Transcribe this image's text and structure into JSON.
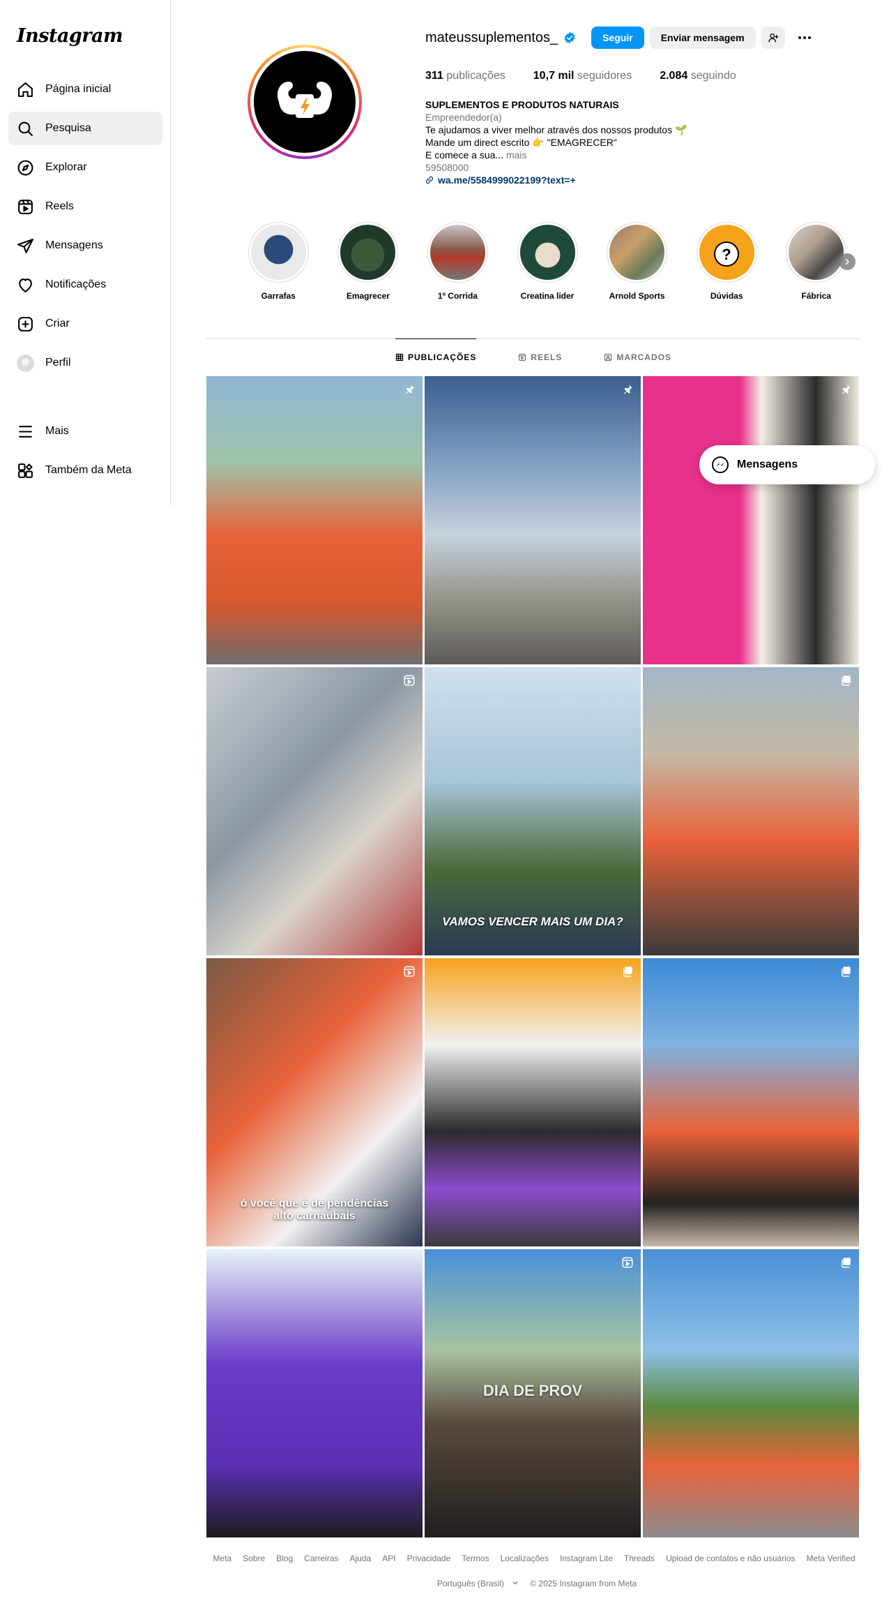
{
  "app": {
    "logo": "Instagram"
  },
  "nav": {
    "items": [
      {
        "label": "Página inicial",
        "icon": "home-icon"
      },
      {
        "label": "Pesquisa",
        "icon": "search-icon"
      },
      {
        "label": "Explorar",
        "icon": "explore-icon"
      },
      {
        "label": "Reels",
        "icon": "reels-icon"
      },
      {
        "label": "Mensagens",
        "icon": "messages-icon"
      },
      {
        "label": "Notificações",
        "icon": "heart-icon"
      },
      {
        "label": "Criar",
        "icon": "create-icon"
      },
      {
        "label": "Perfil",
        "icon": "avatar"
      }
    ],
    "bottom": [
      {
        "label": "Mais",
        "icon": "menu-icon"
      },
      {
        "label": "Também da Meta",
        "icon": "meta-apps-icon"
      }
    ],
    "active": "Pesquisa"
  },
  "profile": {
    "username": "mateussuplementos_",
    "verified": true,
    "follow_label": "Seguir",
    "message_label": "Enviar mensagem",
    "stats": {
      "posts_value": "311",
      "posts_label": "publicações",
      "followers_value": "10,7 mil",
      "followers_label": "seguidores",
      "following_value": "2.084",
      "following_label": "seguindo"
    },
    "bio": {
      "name": "SUPLEMENTOS E PRODUTOS NATURAIS",
      "category": "Empreendedor(a)",
      "line1": "Te ajudamos a viver melhor através dos nossos produtos 🌱",
      "line2": "Mande um direct escrito 👉 \"EMAGRECER\"",
      "line3": "E comece a sua...",
      "more": "mais",
      "line4": "59508000",
      "link": "wa.me/5584999022199?text=+"
    }
  },
  "highlights": [
    {
      "label": "Garrafas",
      "color": "#2b4a7a"
    },
    {
      "label": "Emagrecer",
      "color": "#3a5a3a"
    },
    {
      "label": "1º Corrida",
      "color": "#8a5a4a"
    },
    {
      "label": "Creatina lider",
      "color": "#c9a06a"
    },
    {
      "label": "Arnold Sports",
      "color": "#9a7a6a"
    },
    {
      "label": "Dúvidas",
      "color": "#f7a21b"
    },
    {
      "label": "Fábrica",
      "color": "#b0a090"
    }
  ],
  "tabs": [
    {
      "label": "PUBLICAÇÕES",
      "icon": "grid-icon",
      "active": true
    },
    {
      "label": "REELS",
      "icon": "reels-icon",
      "active": false
    },
    {
      "label": "MARCADOS",
      "icon": "tagged-icon",
      "active": false
    }
  ],
  "posts": [
    {
      "badge": "pin-icon",
      "bg": "linear-gradient(180deg,#8fb7d6 0%,#9fc3a8 30%,#e8623a 55%,#d4582f 80%,#6d6d6d 100%)",
      "caption": ""
    },
    {
      "badge": "pin-icon",
      "bg": "linear-gradient(180deg,#3a5f8f 0%,#8ea8c8 35%,#c7d2de 55%,#9a9a92 75%,#5d5a55 100%)",
      "caption": ""
    },
    {
      "badge": "pin-icon",
      "bg": "linear-gradient(90deg,#e8318a 0%,#e8318a 45%,#f4eee4 55%,#2b2b2b 80%,#f1ece2 100%)",
      "caption": ""
    },
    {
      "badge": "reel-icon",
      "bg": "linear-gradient(135deg,#c9cdd2 0%,#8c97a3 40%,#d8d4cc 65%,#b33a3a 100%)",
      "caption": ""
    },
    {
      "badge": "",
      "bg": "linear-gradient(180deg,#cfe1ee 0%,#a7c4d9 40%,#4b6a3a 70%,#2b3a55 100%)",
      "caption": "VAMOS VENCER MAIS UM DIA?"
    },
    {
      "badge": "carousel-icon",
      "bg": "linear-gradient(180deg,#a3b6c6 0%,#c4b8a6 30%,#e8623a 60%,#3b3b3b 100%)",
      "caption": ""
    },
    {
      "badge": "reel-icon",
      "bg": "linear-gradient(135deg,#7a5a44 0%,#e8623a 40%,#f1f1f1 70%,#2a3550 100%)",
      "caption": "ó você que é de pendências alto carnaubais"
    },
    {
      "badge": "carousel-icon",
      "bg": "linear-gradient(180deg,#f7a21b 0%,#f1f1f1 30%,#2b2b2b 60%,#8c4bd0 80%,#3b3b3b 100%)",
      "caption": ""
    },
    {
      "badge": "carousel-icon",
      "bg": "linear-gradient(180deg,#3d8ad6 0%,#7fb2e0 30%,#e8623a 60%,#222 85%,#c9b8a8 100%)",
      "caption": ""
    },
    {
      "badge": "",
      "bg": "linear-gradient(180deg,#e8f2f6 0%,#6a3cc9 40%,#5a2fb5 75%,#1d1d1d 100%)",
      "caption": ""
    },
    {
      "badge": "reel-icon",
      "bg": "linear-gradient(180deg,#4a90d9 0%,#a8c4a0 35%,#5a4a3e 60%,#1f1f1f 100%)",
      "caption": "DIA DE PROV"
    },
    {
      "badge": "carousel-icon",
      "bg": "linear-gradient(180deg,#4a8fd6 0%,#8fc0e6 35%,#5b8a3e 55%,#e8623a 75%,#8c8c8c 100%)",
      "caption": ""
    }
  ],
  "floating": {
    "messages_label": "Mensagens"
  },
  "footer": {
    "links": [
      "Meta",
      "Sobre",
      "Blog",
      "Carreiras",
      "Ajuda",
      "API",
      "Privacidade",
      "Termos",
      "Localizações",
      "Instagram Lite",
      "Threads",
      "Upload de contatos e não usuários",
      "Meta Verified"
    ],
    "language": "Português (Brasil)",
    "copyright": "© 2025 Instagram from Meta"
  }
}
